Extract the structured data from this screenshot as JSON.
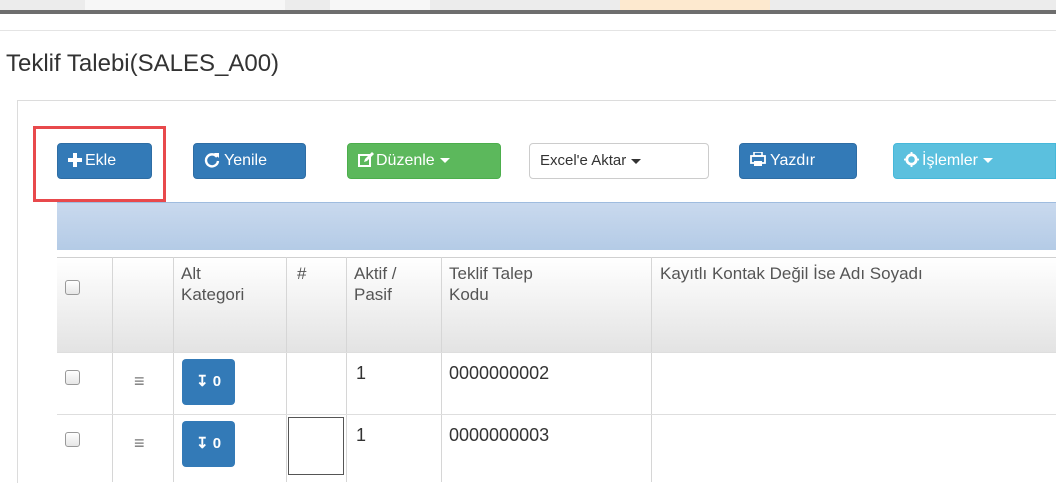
{
  "page": {
    "title": "Teklif Talebi(SALES_A00)"
  },
  "toolbar": {
    "add_label": "Ekle",
    "refresh_label": "Yenile",
    "edit_label": "Düzenle",
    "excel_label": "Excel'e Aktar",
    "print_label": "Yazdır",
    "actions_label": "İşlemler"
  },
  "table": {
    "headers": {
      "subcategory_line1": "Alt",
      "subcategory_line2": "Kategori",
      "hash": "#",
      "active_line1": "Aktif /",
      "active_line2": "Pasif",
      "code_line1": "Teklif Talep",
      "code_line2": "Kodu",
      "contact": "Kayıtlı Kontak Değil İse Adı Soyadı"
    },
    "rows": [
      {
        "subcategory_count": "0",
        "active": "1",
        "code": "0000000002"
      },
      {
        "subcategory_count": "0",
        "active": "1",
        "code": "0000000003"
      }
    ]
  },
  "icons": {
    "add": "plus-icon",
    "refresh": "refresh-icon",
    "edit": "edit-icon",
    "print": "print-icon",
    "actions": "gear-icon",
    "row_menu": "hamburger-icon",
    "subcategory": "arrow-down-icon"
  },
  "colors": {
    "primary": "#337ab7",
    "success": "#5cb85c",
    "info": "#5bc0de",
    "highlight": "#e8494c"
  }
}
